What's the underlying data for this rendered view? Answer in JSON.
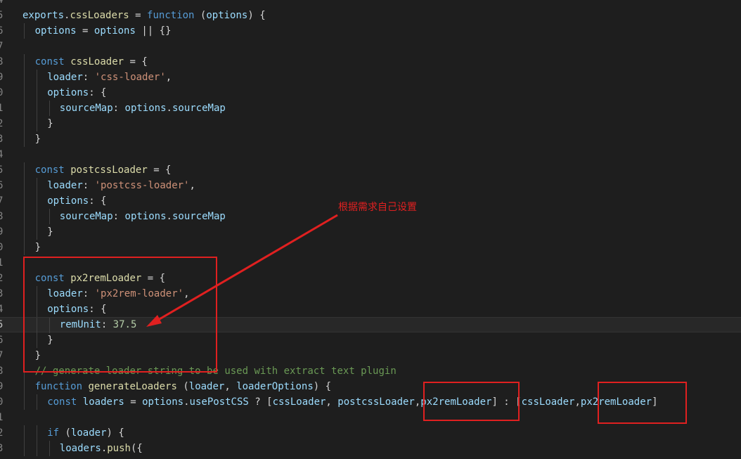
{
  "editor": {
    "lines": [
      {
        "num": "4",
        "tokens": []
      },
      {
        "num": "5",
        "tokens": [
          [
            "var",
            "exports"
          ],
          [
            "punc",
            "."
          ],
          [
            "fn",
            "cssLoaders"
          ],
          [
            "punc",
            " = "
          ],
          [
            "kw",
            "function"
          ],
          [
            "punc",
            " ("
          ],
          [
            "var",
            "options"
          ],
          [
            "punc",
            ") {"
          ]
        ]
      },
      {
        "num": "6",
        "indent": 1,
        "tokens": [
          [
            "var",
            "options"
          ],
          [
            "punc",
            " = "
          ],
          [
            "var",
            "options"
          ],
          [
            "punc",
            " || {}"
          ]
        ]
      },
      {
        "num": "7",
        "tokens": []
      },
      {
        "num": "8",
        "indent": 1,
        "tokens": [
          [
            "kw",
            "const"
          ],
          [
            "punc",
            " "
          ],
          [
            "fn",
            "cssLoader"
          ],
          [
            "punc",
            " = {"
          ]
        ]
      },
      {
        "num": "9",
        "indent": 2,
        "tokens": [
          [
            "var",
            "loader"
          ],
          [
            "punc",
            ": "
          ],
          [
            "str",
            "'css-loader'"
          ],
          [
            "punc",
            ","
          ]
        ]
      },
      {
        "num": "0",
        "indent": 2,
        "tokens": [
          [
            "var",
            "options"
          ],
          [
            "punc",
            ": {"
          ]
        ]
      },
      {
        "num": "1",
        "indent": 3,
        "tokens": [
          [
            "var",
            "sourceMap"
          ],
          [
            "punc",
            ": "
          ],
          [
            "var",
            "options"
          ],
          [
            "punc",
            "."
          ],
          [
            "var",
            "sourceMap"
          ]
        ]
      },
      {
        "num": "2",
        "indent": 2,
        "tokens": [
          [
            "punc",
            "}"
          ]
        ]
      },
      {
        "num": "3",
        "indent": 1,
        "tokens": [
          [
            "punc",
            "}"
          ]
        ]
      },
      {
        "num": "4",
        "tokens": []
      },
      {
        "num": "5",
        "indent": 1,
        "tokens": [
          [
            "kw",
            "const"
          ],
          [
            "punc",
            " "
          ],
          [
            "fn",
            "postcssLoader"
          ],
          [
            "punc",
            " = {"
          ]
        ]
      },
      {
        "num": "6",
        "indent": 2,
        "tokens": [
          [
            "var",
            "loader"
          ],
          [
            "punc",
            ": "
          ],
          [
            "str",
            "'postcss-loader'"
          ],
          [
            "punc",
            ","
          ]
        ]
      },
      {
        "num": "7",
        "indent": 2,
        "tokens": [
          [
            "var",
            "options"
          ],
          [
            "punc",
            ": {"
          ]
        ]
      },
      {
        "num": "8",
        "indent": 3,
        "tokens": [
          [
            "var",
            "sourceMap"
          ],
          [
            "punc",
            ": "
          ],
          [
            "var",
            "options"
          ],
          [
            "punc",
            "."
          ],
          [
            "var",
            "sourceMap"
          ]
        ]
      },
      {
        "num": "9",
        "indent": 2,
        "tokens": [
          [
            "punc",
            "}"
          ]
        ]
      },
      {
        "num": "0",
        "indent": 1,
        "tokens": [
          [
            "punc",
            "}"
          ]
        ]
      },
      {
        "num": "1",
        "tokens": []
      },
      {
        "num": "2",
        "indent": 1,
        "tokens": [
          [
            "kw",
            "const"
          ],
          [
            "punc",
            " "
          ],
          [
            "fn",
            "px2remLoader"
          ],
          [
            "punc",
            " = {"
          ]
        ]
      },
      {
        "num": "3",
        "indent": 2,
        "tokens": [
          [
            "var",
            "loader"
          ],
          [
            "punc",
            ": "
          ],
          [
            "str",
            "'px2rem-loader'"
          ],
          [
            "punc",
            ","
          ]
        ]
      },
      {
        "num": "4",
        "indent": 2,
        "tokens": [
          [
            "var",
            "options"
          ],
          [
            "punc",
            ": "
          ],
          [
            "punc",
            "{"
          ]
        ]
      },
      {
        "num": "5",
        "indent": 3,
        "current": true,
        "tokens": [
          [
            "var",
            "remUnit"
          ],
          [
            "punc",
            ": "
          ],
          [
            "num",
            "37.5"
          ]
        ]
      },
      {
        "num": "6",
        "indent": 2,
        "tokens": [
          [
            "punc",
            "}"
          ]
        ]
      },
      {
        "num": "7",
        "indent": 1,
        "tokens": [
          [
            "punc",
            "}"
          ]
        ]
      },
      {
        "num": "8",
        "indent": 1,
        "tokens": [
          [
            "cmt",
            "// generate loader string to be used with extract text plugin"
          ]
        ]
      },
      {
        "num": "9",
        "indent": 1,
        "tokens": [
          [
            "kw",
            "function"
          ],
          [
            "punc",
            " "
          ],
          [
            "fn",
            "generateLoaders"
          ],
          [
            "punc",
            " ("
          ],
          [
            "var",
            "loader"
          ],
          [
            "punc",
            ", "
          ],
          [
            "var",
            "loaderOptions"
          ],
          [
            "punc",
            ") {"
          ]
        ]
      },
      {
        "num": "0",
        "indent": 2,
        "tokens": [
          [
            "kw",
            "const"
          ],
          [
            "punc",
            " "
          ],
          [
            "var",
            "loaders"
          ],
          [
            "punc",
            " = "
          ],
          [
            "var",
            "options"
          ],
          [
            "punc",
            "."
          ],
          [
            "var",
            "usePostCSS"
          ],
          [
            "punc",
            " ? ["
          ],
          [
            "var",
            "cssLoader"
          ],
          [
            "punc",
            ", "
          ],
          [
            "var",
            "postcssLoader"
          ],
          [
            "punc",
            ","
          ],
          [
            "var",
            "px2remLoader"
          ],
          [
            "punc",
            "] : ["
          ],
          [
            "var",
            "cssLoader"
          ],
          [
            "punc",
            ","
          ],
          [
            "var",
            "px2remLoader"
          ],
          [
            "punc",
            "]"
          ]
        ]
      },
      {
        "num": "1",
        "tokens": []
      },
      {
        "num": "2",
        "indent": 2,
        "tokens": [
          [
            "kw",
            "if"
          ],
          [
            "punc",
            " ("
          ],
          [
            "var",
            "loader"
          ],
          [
            "punc",
            ") {"
          ]
        ]
      },
      {
        "num": "3",
        "indent": 3,
        "tokens": [
          [
            "var",
            "loaders"
          ],
          [
            "punc",
            "."
          ],
          [
            "fn",
            "push"
          ],
          [
            "punc",
            "({"
          ]
        ]
      }
    ]
  },
  "annotation": {
    "text": "根据需求自己设置",
    "color": "#e02020"
  },
  "colors": {
    "background": "#1e1e1e",
    "keyword": "#569cd6",
    "function": "#dcdcaa",
    "variable": "#9cdcfe",
    "string": "#ce9178",
    "number": "#b5cea8",
    "comment": "#6a9955"
  }
}
